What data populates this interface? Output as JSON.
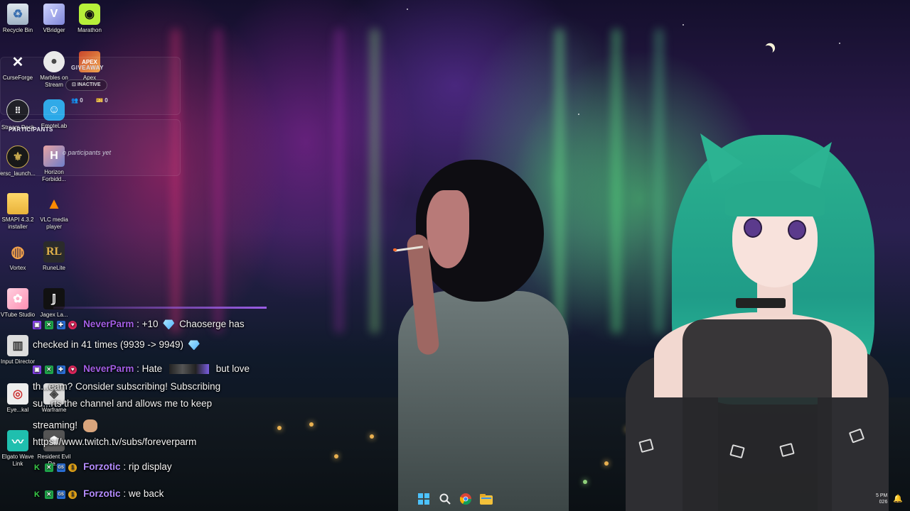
{
  "desktop_icons": [
    {
      "label": "Recycle Bin",
      "icon": "recycle-bin-icon"
    },
    {
      "label": "VBridger",
      "icon": "vbridger-icon"
    },
    {
      "label": "Marathon",
      "icon": "marathon-icon"
    },
    {
      "label": "CurseForge",
      "icon": "curseforge-icon"
    },
    {
      "label": "Marbles on Stream",
      "icon": "marbles-icon"
    },
    {
      "label": "Apex",
      "icon": "apex-icon"
    },
    {
      "label": "Stream Deck",
      "icon": "stream-deck-icon"
    },
    {
      "label": "EmoteLab",
      "icon": "emotelab-icon"
    },
    {
      "label": "ersc_launch...",
      "icon": "ersc-launcher-icon"
    },
    {
      "label": "Horizon Forbidd...",
      "icon": "horizon-icon"
    },
    {
      "label": "SMAPI 4.3.2 installer",
      "icon": "folder-icon"
    },
    {
      "label": "VLC media player",
      "icon": "vlc-icon"
    },
    {
      "label": "Vortex",
      "icon": "vortex-icon"
    },
    {
      "label": "RuneLite",
      "icon": "runelite-icon"
    },
    {
      "label": "VTube Studio",
      "icon": "vtube-studio-icon"
    },
    {
      "label": "Jagex La...",
      "icon": "jagex-icon"
    },
    {
      "label": "Input Director",
      "icon": "input-director-icon"
    },
    {
      "label": "Eye...kal",
      "icon": "eye-icon"
    },
    {
      "label": "Warframe",
      "icon": "warframe-icon"
    },
    {
      "label": "Elgato Wave Link",
      "icon": "elgato-wave-icon"
    },
    {
      "label": "Resident Evil Re...",
      "icon": "resident-evil-icon"
    }
  ],
  "giveaway": {
    "title": "GIVEAWAY",
    "status": "INACTIVE",
    "entrants": "0",
    "tickets": "0",
    "participants_title": "PARTICIPANTS",
    "empty_text": "o participants yet"
  },
  "chat": [
    {
      "user": "NeverParm",
      "color": "#a35ee6",
      "text_before": ": +10",
      "text_after": "Chaoserge has",
      "continuation": "checked in 41 times (9939 -> 9949)"
    },
    {
      "user": "NeverParm",
      "color": "#a35ee6",
      "text_before": ": Hate",
      "text_after": "but love",
      "lines": [
        "th...eam? Consider subscribing! Subscribing",
        "su...rts the channel and allows me to keep",
        "streaming!",
        "https://www.twitch.tv/subs/foreverparm"
      ]
    },
    {
      "user": "Forzotic",
      "color": "#b48cff",
      "text": ": rip display"
    },
    {
      "user": "Forzotic",
      "color": "#b48cff",
      "text": ": we back"
    }
  ],
  "taskbar": {
    "items": [
      "windows-start-icon",
      "search-icon",
      "chrome-icon",
      "file-explorer-icon"
    ],
    "time": "5 PM",
    "date": "026"
  },
  "colors": {
    "chat_name_purple": "#a35ee6",
    "accent_purple": "#9b5de5"
  }
}
